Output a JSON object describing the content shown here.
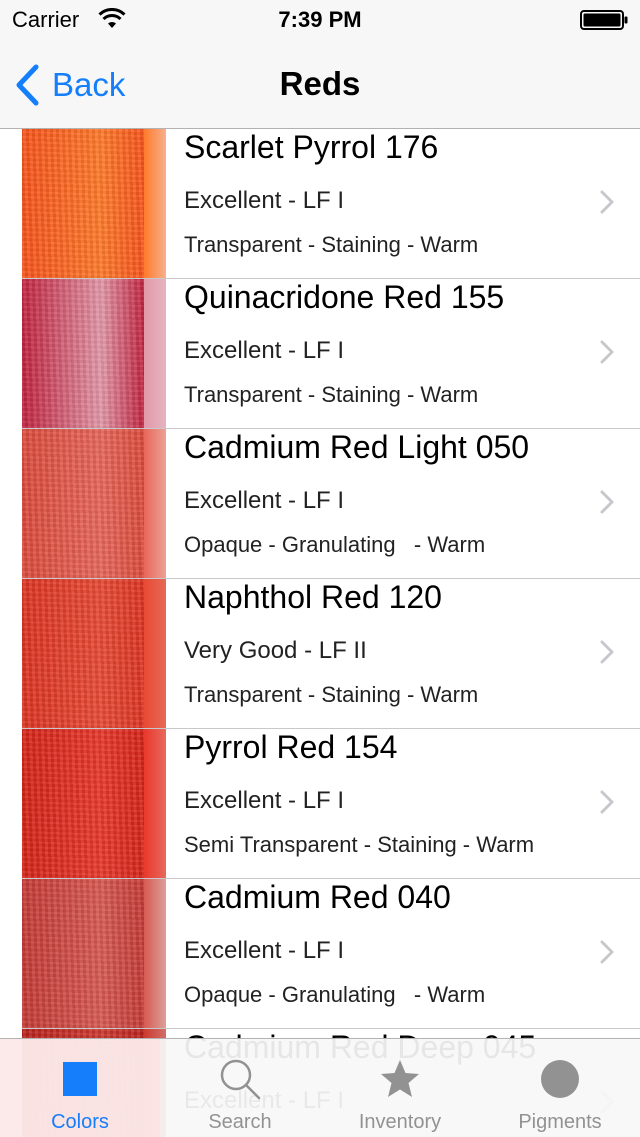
{
  "status_bar": {
    "carrier": "Carrier",
    "time": "7:39 PM",
    "icons": [
      "wifi-icon",
      "battery-icon"
    ]
  },
  "nav": {
    "back_label": "Back",
    "title": "Reds",
    "accent": "#157efb"
  },
  "paints": [
    {
      "name": "Scarlet Pyrrol 176",
      "rating": "Excellent - LF I",
      "properties": "Transparent - Staining - Warm",
      "swatch": {
        "base": "#f8531b",
        "light": "#ff7a2a",
        "edge": "#f7b08e"
      }
    },
    {
      "name": "Quinacridone Red 155",
      "rating": "Excellent - LF I",
      "properties": "Transparent - Staining - Warm",
      "swatch": {
        "base": "#c2223f",
        "light": "#e398a9",
        "edge": "#e4b4bf"
      }
    },
    {
      "name": "Cadmium Red Light 050",
      "rating": "Excellent - LF I",
      "properties": "Opaque - Granulating   - Warm",
      "swatch": {
        "base": "#dc4a3c",
        "light": "#e8675a",
        "edge": "#eba296"
      }
    },
    {
      "name": "Naphthol Red 120",
      "rating": "Very Good - LF II",
      "properties": "Transparent - Staining - Warm",
      "swatch": {
        "base": "#dd3321",
        "light": "#e84a35",
        "edge": "#e66a55"
      }
    },
    {
      "name": "Pyrrol Red 154",
      "rating": "Excellent - LF I",
      "properties": "Semi Transparent - Staining - Warm",
      "swatch": {
        "base": "#d52317",
        "light": "#e8382b",
        "edge": "#e8695e"
      }
    },
    {
      "name": "Cadmium Red 040",
      "rating": "Excellent - LF I",
      "properties": "Opaque - Granulating   - Warm",
      "swatch": {
        "base": "#c53a35",
        "light": "#d75a52",
        "edge": "#dba19a"
      }
    },
    {
      "name": "Cadmium Red Deep 045",
      "rating": "Excellent - LF I",
      "properties": "",
      "swatch": {
        "base": "#b8201c",
        "light": "#cc3a30",
        "edge": "#d07068"
      }
    }
  ],
  "tabs": [
    {
      "label": "Colors",
      "icon": "square-icon",
      "active": true
    },
    {
      "label": "Search",
      "icon": "magnifier-icon",
      "active": false
    },
    {
      "label": "Inventory",
      "icon": "star-icon",
      "active": false
    },
    {
      "label": "Pigments",
      "icon": "circle-icon",
      "active": false
    }
  ]
}
